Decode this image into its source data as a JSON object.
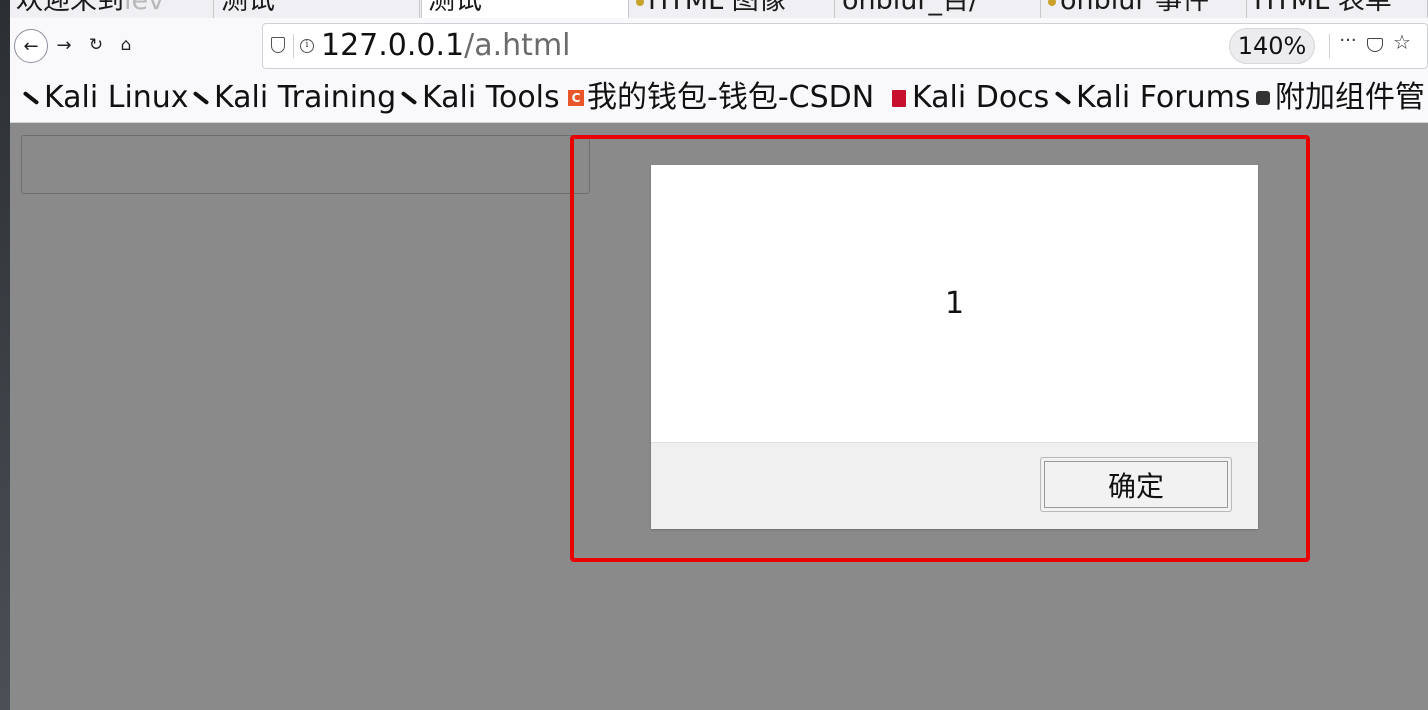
{
  "tabs": [
    {
      "label": "欢迎来到",
      "faded": "lev",
      "active": false
    },
    {
      "label": "测试",
      "active": false
    },
    {
      "label": "测试",
      "active": true
    },
    {
      "label": "HTML 图像",
      "active": false
    },
    {
      "label": "onblur_百/",
      "active": false
    },
    {
      "label": "onblur 事件",
      "active": false
    },
    {
      "label": "HTML 表单",
      "active": false
    }
  ],
  "nav": {
    "url_host": "127.0.0.1",
    "url_path": "/a.html",
    "zoom": "140%"
  },
  "bookmarks": [
    {
      "label": "Kali Linux",
      "icon": "kali-dragon-icon"
    },
    {
      "label": "Kali Training",
      "icon": "kali-dragon-icon"
    },
    {
      "label": "Kali Tools",
      "icon": "kali-dragon-icon"
    },
    {
      "label": "我的钱包-钱包-CSDN",
      "icon": "csdn-icon"
    },
    {
      "label": "Kali Docs",
      "icon": "kali-docs-icon"
    },
    {
      "label": "Kali Forums",
      "icon": "kali-dragon-icon"
    },
    {
      "label": "附加组件管",
      "icon": "puzzle-icon"
    }
  ],
  "dialog": {
    "message": "1",
    "ok_label": "确定"
  },
  "colors": {
    "overlay": "#8a8a8a",
    "highlight_border": "#e80000"
  }
}
